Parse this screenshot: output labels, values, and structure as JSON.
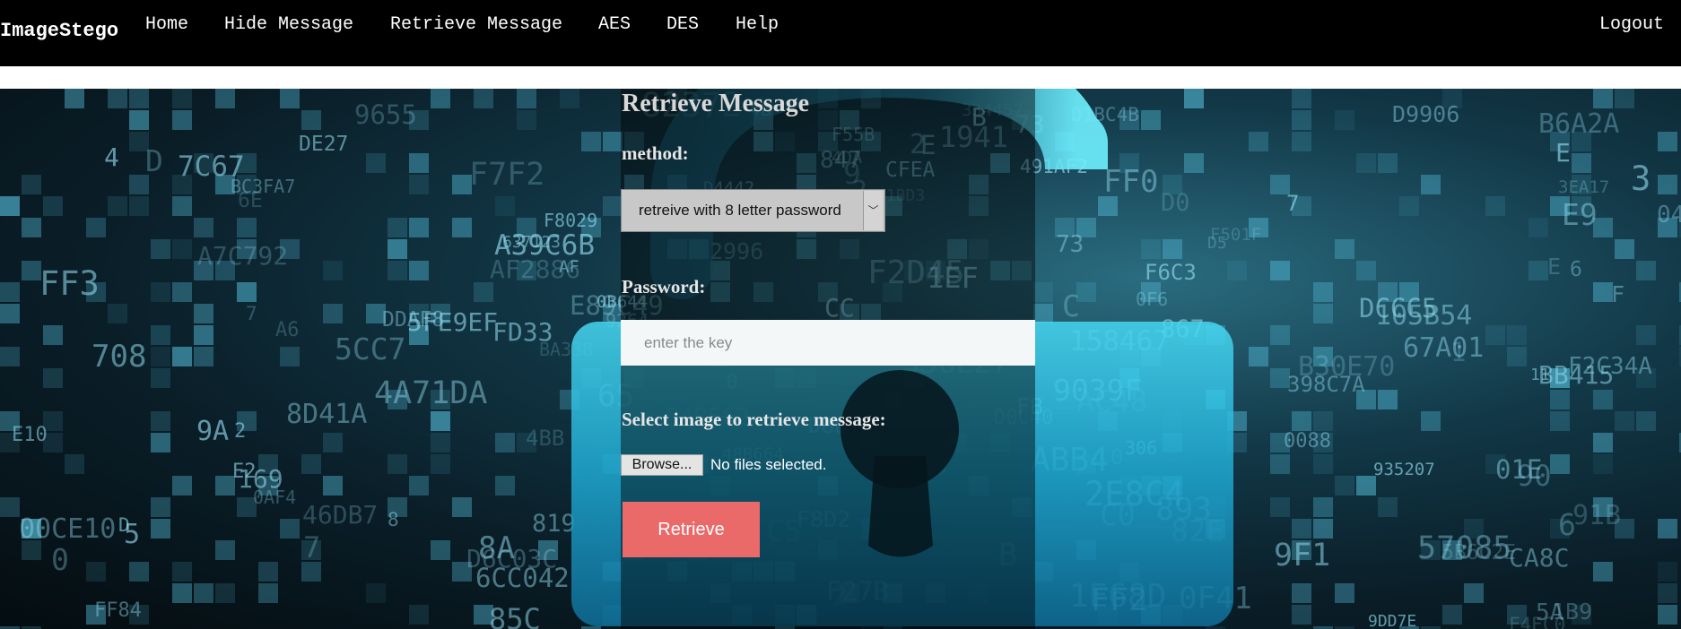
{
  "nav": {
    "brand": "ImageStego",
    "items": [
      "Home",
      "Hide Message",
      "Retrieve Message",
      "AES",
      "DES",
      "Help"
    ],
    "logout": "Logout"
  },
  "form": {
    "title": "Retrieve Message",
    "method_label": "method:",
    "method_selected": "retreive with 8 letter password",
    "password_label": "Password:",
    "password_placeholder": "enter the key",
    "image_label": "Select image to retrieve message:",
    "browse_label": "Browse...",
    "file_status": "No files selected.",
    "submit_label": "Retrieve"
  },
  "colors": {
    "nav_bg": "#000000",
    "submit_bg": "#ea6a6a",
    "lock_cyan": "#2bc4e4"
  },
  "icons": [
    "chevron-down-icon",
    "padlock-icon"
  ]
}
